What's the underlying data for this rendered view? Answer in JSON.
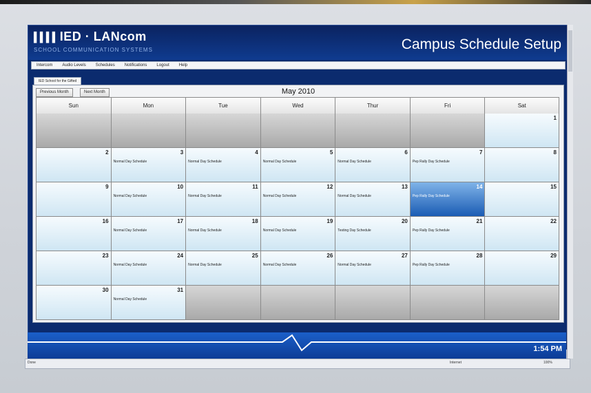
{
  "app": {
    "logo": "IED · LANcom",
    "tagline": "SCHOOL COMMUNICATION SYSTEMS",
    "page_title": "Campus Schedule Setup"
  },
  "menu": [
    "Intercom",
    "Audio Levels",
    "Schedules",
    "Notifications",
    "Logout",
    "Help"
  ],
  "tab_label": "IED School for the Gifted",
  "nav": {
    "prev": "Previous Month",
    "next": "Next Month"
  },
  "calendar": {
    "month_title": "May  2010",
    "days_of_week": [
      "Sun",
      "Mon",
      "Tue",
      "Wed",
      "Thur",
      "Fri",
      "Sat"
    ],
    "weeks": [
      [
        null,
        null,
        null,
        null,
        null,
        null,
        {
          "day": "1",
          "schedule": ""
        }
      ],
      [
        {
          "day": "2",
          "schedule": ""
        },
        {
          "day": "3",
          "schedule": "Normal Day Schedule"
        },
        {
          "day": "4",
          "schedule": "Normal Day Schedule"
        },
        {
          "day": "5",
          "schedule": "Normal Day Schedule"
        },
        {
          "day": "6",
          "schedule": "Normal Day Schedule"
        },
        {
          "day": "7",
          "schedule": "Pep Rally Day Schedule"
        },
        {
          "day": "8",
          "schedule": ""
        }
      ],
      [
        {
          "day": "9",
          "schedule": ""
        },
        {
          "day": "10",
          "schedule": "Normal Day Schedule"
        },
        {
          "day": "11",
          "schedule": "Normal Day Schedule"
        },
        {
          "day": "12",
          "schedule": "Normal Day Schedule"
        },
        {
          "day": "13",
          "schedule": "Normal Day Schedule"
        },
        {
          "day": "14",
          "schedule": "Pep Rally Day Schedule",
          "selected": true
        },
        {
          "day": "15",
          "schedule": ""
        }
      ],
      [
        {
          "day": "16",
          "schedule": ""
        },
        {
          "day": "17",
          "schedule": "Normal Day Schedule"
        },
        {
          "day": "18",
          "schedule": "Normal Day Schedule"
        },
        {
          "day": "19",
          "schedule": "Normal Day Schedule"
        },
        {
          "day": "20",
          "schedule": "Testing Day Schedule"
        },
        {
          "day": "21",
          "schedule": "Pep Rally Day Schedule"
        },
        {
          "day": "22",
          "schedule": ""
        }
      ],
      [
        {
          "day": "23",
          "schedule": ""
        },
        {
          "day": "24",
          "schedule": "Normal Day Schedule"
        },
        {
          "day": "25",
          "schedule": "Normal Day Schedule"
        },
        {
          "day": "26",
          "schedule": "Normal Day Schedule"
        },
        {
          "day": "27",
          "schedule": "Normal Day Schedule"
        },
        {
          "day": "28",
          "schedule": "Pep Rally Day Schedule"
        },
        {
          "day": "29",
          "schedule": ""
        }
      ],
      [
        {
          "day": "30",
          "schedule": ""
        },
        {
          "day": "31",
          "schedule": "Normal Day Schedule"
        },
        null,
        null,
        null,
        null,
        null
      ]
    ]
  },
  "clock": "1:54 PM",
  "status": {
    "left": "Done",
    "zone": "Internet",
    "zoom": "100%"
  },
  "colors": {
    "header": "#0f3b8f",
    "selected": "#1b5cb4",
    "cell": "#cfe6f3"
  }
}
